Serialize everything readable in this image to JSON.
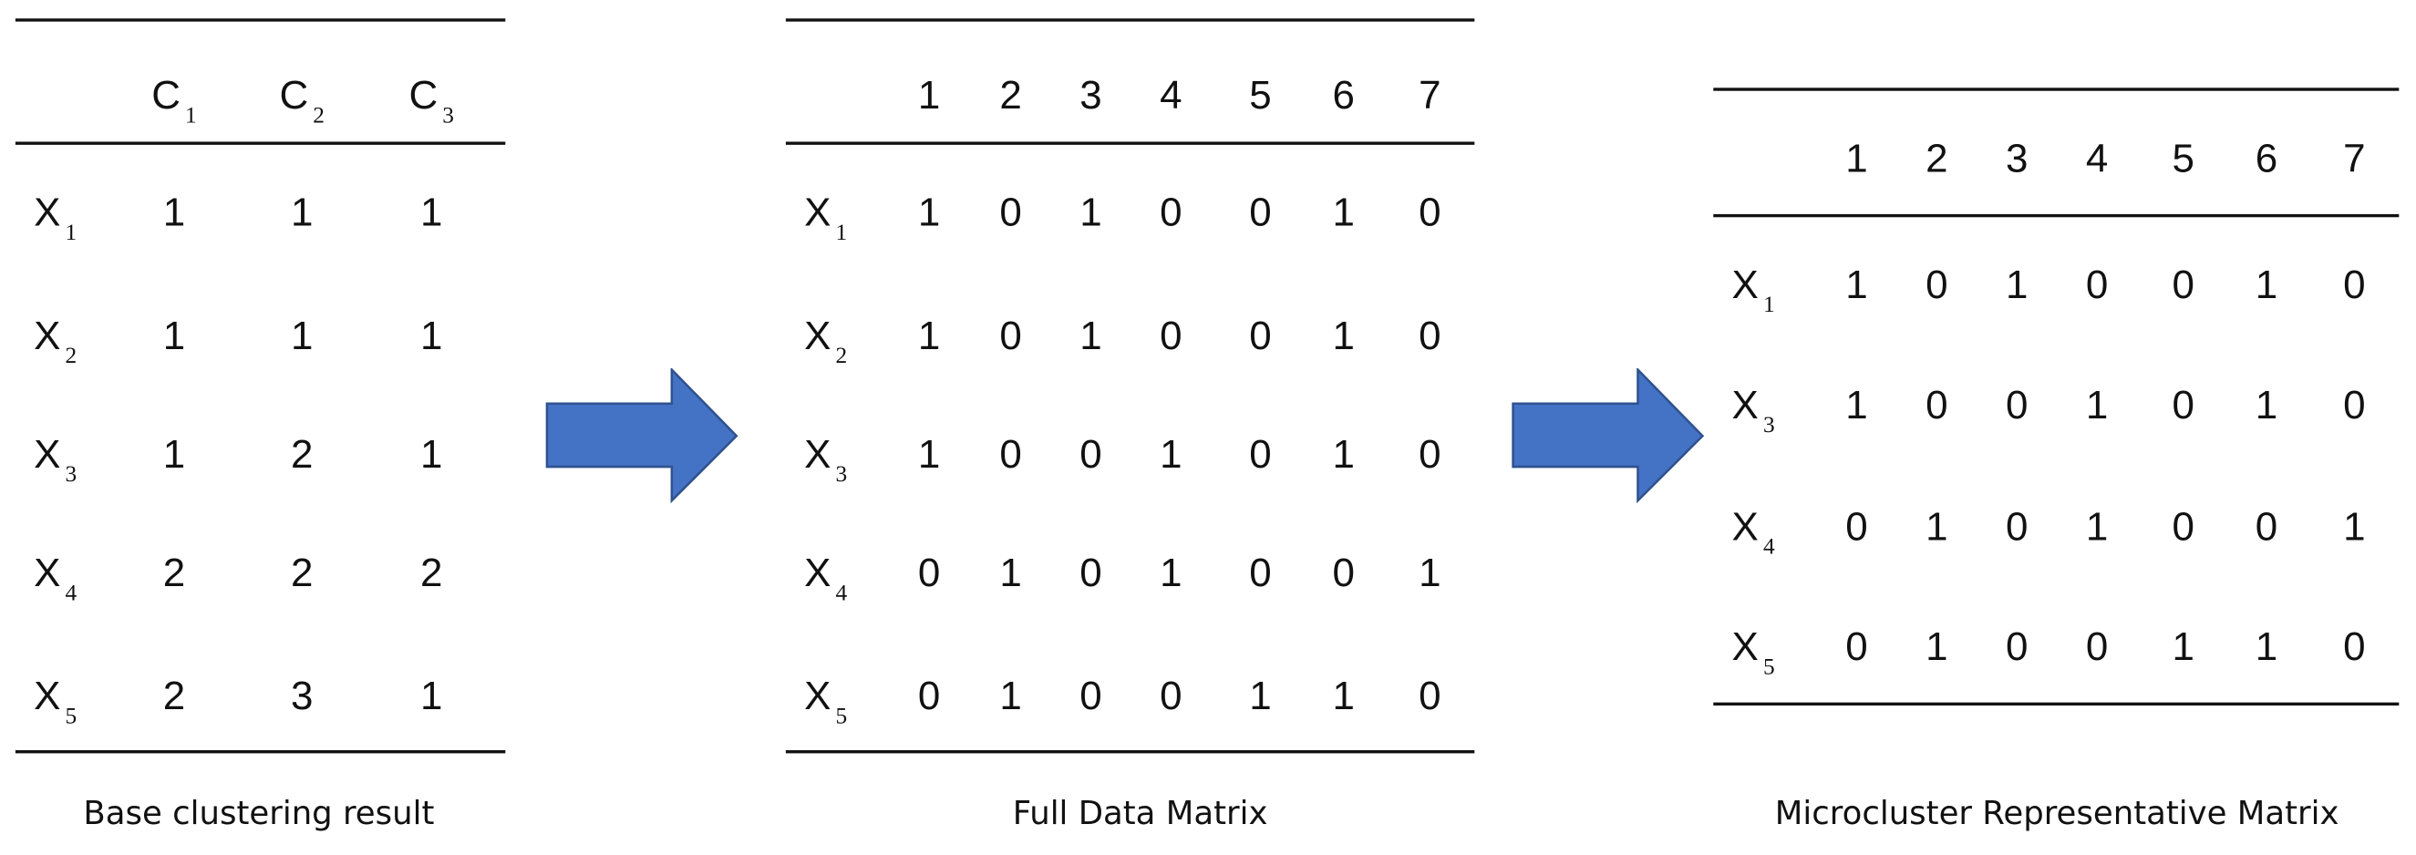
{
  "colors": {
    "arrow_fill": "#4472C4",
    "arrow_stroke": "#2F528F",
    "rule": "#111111"
  },
  "tables": [
    {
      "caption": "Base clustering result",
      "columns": [
        {
          "base": "C",
          "sub": "1"
        },
        {
          "base": "C",
          "sub": "2"
        },
        {
          "base": "C",
          "sub": "3"
        }
      ],
      "rows": [
        {
          "label": {
            "base": "X",
            "sub": "1"
          },
          "values": [
            "1",
            "1",
            "1"
          ]
        },
        {
          "label": {
            "base": "X",
            "sub": "2"
          },
          "values": [
            "1",
            "1",
            "1"
          ]
        },
        {
          "label": {
            "base": "X",
            "sub": "3"
          },
          "values": [
            "1",
            "2",
            "1"
          ]
        },
        {
          "label": {
            "base": "X",
            "sub": "4"
          },
          "values": [
            "2",
            "2",
            "2"
          ]
        },
        {
          "label": {
            "base": "X",
            "sub": "5"
          },
          "values": [
            "2",
            "3",
            "1"
          ]
        }
      ]
    },
    {
      "caption": "Full Data Matrix",
      "columns": [
        {
          "base": "1"
        },
        {
          "base": "2"
        },
        {
          "base": "3"
        },
        {
          "base": "4"
        },
        {
          "base": "5"
        },
        {
          "base": "6"
        },
        {
          "base": "7"
        }
      ],
      "rows": [
        {
          "label": {
            "base": "X",
            "sub": "1"
          },
          "values": [
            "1",
            "0",
            "1",
            "0",
            "0",
            "1",
            "0"
          ]
        },
        {
          "label": {
            "base": "X",
            "sub": "2"
          },
          "values": [
            "1",
            "0",
            "1",
            "0",
            "0",
            "1",
            "0"
          ]
        },
        {
          "label": {
            "base": "X",
            "sub": "3"
          },
          "values": [
            "1",
            "0",
            "0",
            "1",
            "0",
            "1",
            "0"
          ]
        },
        {
          "label": {
            "base": "X",
            "sub": "4"
          },
          "values": [
            "0",
            "1",
            "0",
            "1",
            "0",
            "0",
            "1"
          ]
        },
        {
          "label": {
            "base": "X",
            "sub": "5"
          },
          "values": [
            "0",
            "1",
            "0",
            "0",
            "1",
            "1",
            "0"
          ]
        }
      ]
    },
    {
      "caption": "Microcluster Representative Matrix",
      "columns": [
        {
          "base": "1"
        },
        {
          "base": "2"
        },
        {
          "base": "3"
        },
        {
          "base": "4"
        },
        {
          "base": "5"
        },
        {
          "base": "6"
        },
        {
          "base": "7"
        }
      ],
      "rows": [
        {
          "label": {
            "base": "X",
            "sub": "1"
          },
          "values": [
            "1",
            "0",
            "1",
            "0",
            "0",
            "1",
            "0"
          ]
        },
        {
          "label": {
            "base": "X",
            "sub": "3"
          },
          "values": [
            "1",
            "0",
            "0",
            "1",
            "0",
            "1",
            "0"
          ]
        },
        {
          "label": {
            "base": "X",
            "sub": "4"
          },
          "values": [
            "0",
            "1",
            "0",
            "1",
            "0",
            "0",
            "1"
          ]
        },
        {
          "label": {
            "base": "X",
            "sub": "5"
          },
          "values": [
            "0",
            "1",
            "0",
            "0",
            "1",
            "1",
            "0"
          ]
        }
      ]
    }
  ],
  "arrows": [
    {
      "icon": "right-arrow-icon"
    },
    {
      "icon": "right-arrow-icon"
    }
  ]
}
